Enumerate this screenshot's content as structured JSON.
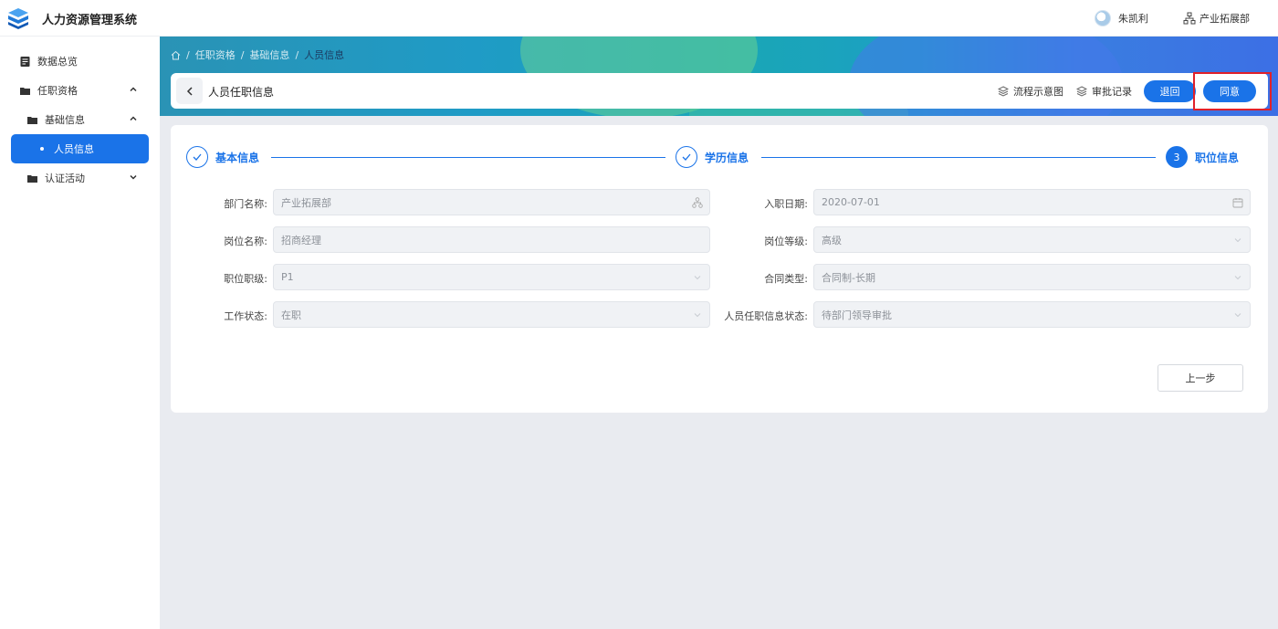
{
  "app": {
    "title": "人力资源管理系统"
  },
  "header": {
    "user_name": "朱凯利",
    "department": "产业拓展部"
  },
  "sidebar": {
    "items": [
      {
        "label": "数据总览",
        "icon": "document-icon"
      },
      {
        "label": "任职资格",
        "icon": "folder-icon",
        "expanded": true
      },
      {
        "label": "基础信息",
        "icon": "folder-icon",
        "expanded": true
      },
      {
        "label": "人员信息",
        "active": true
      },
      {
        "label": "认证活动",
        "icon": "folder-icon",
        "expanded": false
      }
    ]
  },
  "breadcrumb": {
    "items": [
      "任职资格",
      "基础信息",
      "人员信息"
    ]
  },
  "page_header": {
    "title": "人员任职信息",
    "flow_label": "流程示意图",
    "history_label": "审批记录",
    "return_label": "退回",
    "agree_label": "同意"
  },
  "steps": [
    {
      "label": "基本信息",
      "status": "done"
    },
    {
      "label": "学历信息",
      "status": "done"
    },
    {
      "label": "职位信息",
      "status": "current",
      "number": "3"
    }
  ],
  "form": {
    "department": {
      "label": "部门名称:",
      "value": "产业拓展部"
    },
    "entry_date": {
      "label": "入职日期:",
      "value": "2020-07-01"
    },
    "position_name": {
      "label": "岗位名称:",
      "value": "招商经理"
    },
    "position_level": {
      "label": "岗位等级:",
      "value": "高级"
    },
    "job_grade": {
      "label": "职位职级:",
      "value": "P1"
    },
    "contract_type": {
      "label": "合同类型:",
      "value": "合同制-长期"
    },
    "work_status": {
      "label": "工作状态:",
      "value": "在职"
    },
    "approval_status": {
      "label": "人员任职信息状态:",
      "value": "待部门领导审批"
    }
  },
  "footer": {
    "prev_label": "上一步"
  },
  "colors": {
    "primary": "#1a73e8",
    "highlight": "#e0202a"
  }
}
